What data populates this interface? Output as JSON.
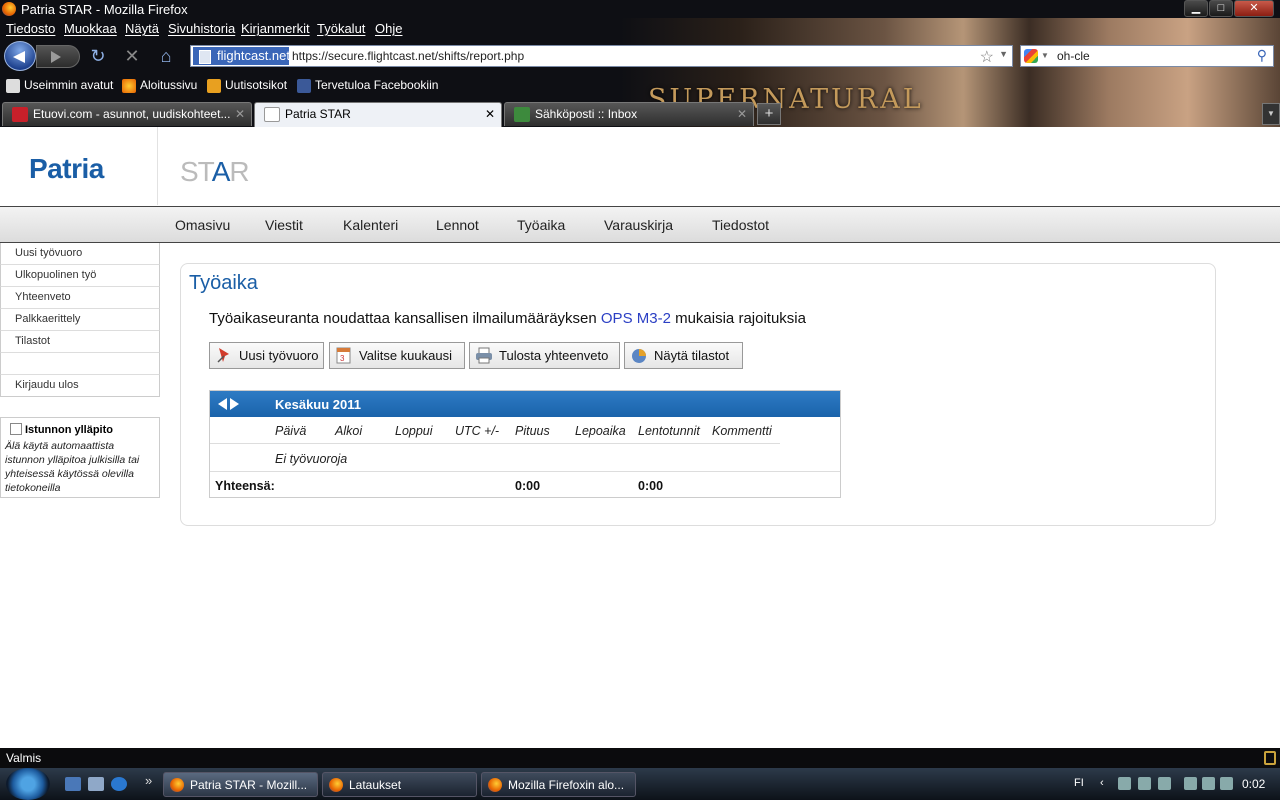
{
  "window": {
    "title": "Patria STAR - Mozilla Firefox",
    "controls": {
      "minimize": "▁",
      "maximize": "□",
      "close": "✕"
    }
  },
  "menu": [
    "Tiedosto",
    "Muokkaa",
    "Näytä",
    "Sivuhistoria",
    "Kirjanmerkit",
    "Työkalut",
    "Ohje"
  ],
  "navigation": {
    "site_identity": "flightcast.net",
    "url": "https://secure.flightcast.net/shifts/report.php",
    "search_value": "oh-cle",
    "icons": [
      "back-icon",
      "forward-icon",
      "reload-icon",
      "stop-icon",
      "home-icon",
      "bookmark-star-icon",
      "search-icon"
    ]
  },
  "bookmarks": [
    "Useimmin avatut",
    "Aloitussivu",
    "Uutisotsikot",
    "Tervetuloa Facebookiin"
  ],
  "banner_text": "SUPERNATURAL",
  "tabs": [
    {
      "label": "Etuovi.com - asunnot, uudiskohteet...",
      "active": false
    },
    {
      "label": "Patria STAR",
      "active": true
    },
    {
      "label": "Sähköposti :: Inbox",
      "active": false
    }
  ],
  "site": {
    "logo": "Patria",
    "product_logo_left": "ST",
    "product_logo_a": "A",
    "product_logo_right": "R"
  },
  "topnav": [
    "Omasivu",
    "Viestit",
    "Kalenteri",
    "Lennot",
    "Työaika",
    "Varauskirja",
    "Tiedostot"
  ],
  "sidenav": [
    "Uusi työvuoro",
    "Ulkopuolinen työ",
    "Yhteenveto",
    "Palkkaerittely",
    "Tilastot",
    "",
    "Kirjaudu ulos"
  ],
  "session": {
    "label": "Istunnon ylläpito",
    "description": "Älä käytä automaattista istunnon ylläpitoa julkisilla tai yhteisessä käytössä olevilla tietokoneilla"
  },
  "main": {
    "heading": "Työaika",
    "intro_before": "Työaikaseuranta noudattaa kansallisen ilmailumääräyksen ",
    "intro_link": "OPS M3-2",
    "intro_after": " mukaisia rajoituksia",
    "buttons": [
      "Uusi työvuoro",
      "Valitse kuukausi",
      "Tulosta yhteenveto",
      "Näytä tilastot"
    ],
    "calendar": {
      "month": "Kesäkuu 2011",
      "columns": [
        "Päivä",
        "Alkoi",
        "Loppui",
        "UTC +/-",
        "Pituus",
        "Lepoaika",
        "Lentotunnit",
        "Kommentti"
      ],
      "empty_text": "Ei työvuoroja",
      "total_label": "Yhteensä:",
      "total_pituus": "0:00",
      "total_lentotunnit": "0:00"
    }
  },
  "status": "Valmis",
  "taskbar": {
    "tasks": [
      "Patria STAR - Mozill...",
      "Lataukset",
      "Mozilla Firefoxin alo..."
    ],
    "language": "FI",
    "time": "0:02"
  },
  "colors": {
    "brand_blue": "#1a5ea6",
    "calendar_header": "#1f6cb5",
    "link": "#2b3fc4"
  }
}
